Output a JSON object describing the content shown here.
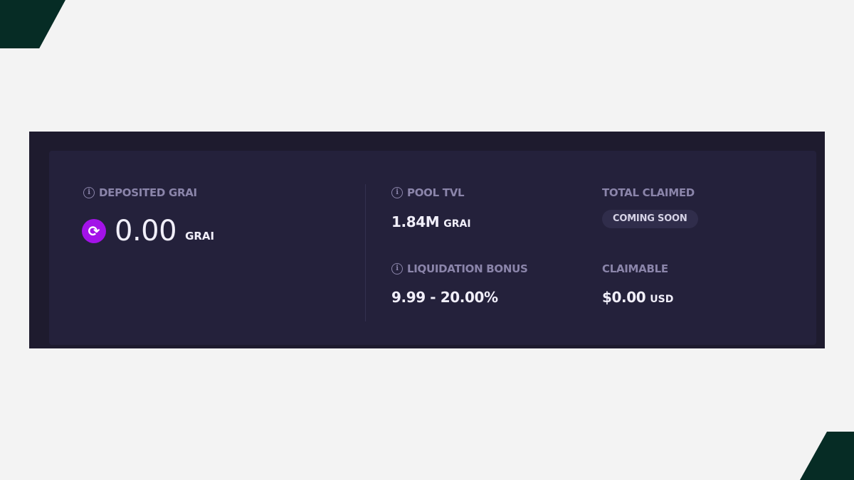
{
  "stats": {
    "deposited": {
      "label": "DEPOSITED GRAI",
      "value": "0.00",
      "unit": "GRAI",
      "token_icon": "grai-token-icon"
    },
    "pool_tvl": {
      "label": "POOL TVL",
      "value": "1.84M",
      "unit": "GRAI"
    },
    "liquidation_bonus": {
      "label": "LIQUIDATION BONUS",
      "value": "9.99 - 20.00%"
    },
    "total_claimed": {
      "label": "TOTAL CLAIMED",
      "badge": "COMING SOON"
    },
    "claimable": {
      "label": "CLAIMABLE",
      "value": "$0.00",
      "unit": "USD"
    }
  },
  "colors": {
    "page_background": "#f3f3f3",
    "corner_accent": "#062c25",
    "card_background": "#24213b",
    "label_text": "#8b85aa",
    "value_text": "#f1effa",
    "token_accent": "#a312e8"
  }
}
